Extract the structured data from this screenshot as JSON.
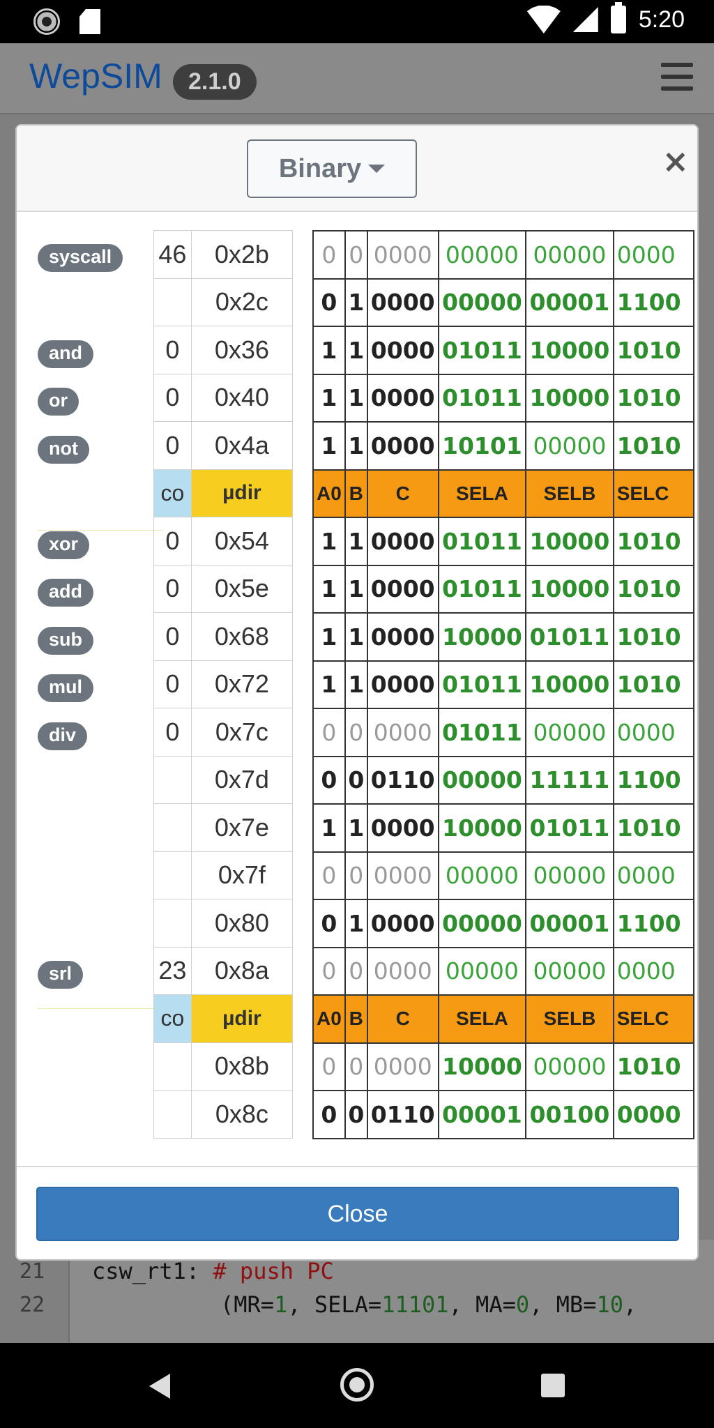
{
  "status_bar": {
    "time": "5:20"
  },
  "app": {
    "brand": "WepSIM",
    "version": "2.1.0",
    "editor": {
      "lines": [
        {
          "number": "21",
          "label": "csw_rt1: ",
          "comment": "# push PC"
        },
        {
          "number": "22",
          "prefix": "(MR=",
          "mr": "1",
          "s1": ", SELA=",
          "sela": "11101",
          "s2": ", MA=",
          "ma": "0",
          "s3": ", MB=",
          "mb": "10",
          "s4": ","
        }
      ]
    }
  },
  "modal": {
    "format_dropdown": "Binary",
    "close_x": "×",
    "close_button": "Close",
    "labels": [
      "syscall",
      "and",
      "or",
      "not",
      "xor",
      "add",
      "sub",
      "mul",
      "div",
      "srl"
    ],
    "header": {
      "co": "co",
      "udir": "µdir",
      "a0": "A0",
      "b": "B",
      "c": "C",
      "sela": "SELA",
      "selb": "SELB",
      "selc": "SELC"
    },
    "rows": [
      {
        "co": "46",
        "udir": "0x2b",
        "a0": "0",
        "b": "0",
        "c": "0000",
        "sela": "00000",
        "selb": "00000",
        "selc": "0000",
        "style": "muted"
      },
      {
        "co": "",
        "udir": "0x2c",
        "a0": "0",
        "b": "1",
        "c": "0000",
        "sela": "00000",
        "selb": "00001",
        "selc": "1100",
        "style": "bold"
      },
      {
        "co": "0",
        "udir": "0x36",
        "a0": "1",
        "b": "1",
        "c": "0000",
        "sela": "01011",
        "selb": "10000",
        "selc": "1010",
        "style": "bold"
      },
      {
        "co": "0",
        "udir": "0x40",
        "a0": "1",
        "b": "1",
        "c": "0000",
        "sela": "01011",
        "selb": "10000",
        "selc": "1010",
        "style": "bold"
      },
      {
        "co": "0",
        "udir": "0x4a",
        "a0": "1",
        "b": "1",
        "c": "0000",
        "sela": "10101",
        "selb": "00000",
        "selc": "1010",
        "style": "bold"
      },
      {
        "header": true
      },
      {
        "co": "0",
        "udir": "0x54",
        "a0": "1",
        "b": "1",
        "c": "0000",
        "sela": "01011",
        "selb": "10000",
        "selc": "1010",
        "style": "bold"
      },
      {
        "co": "0",
        "udir": "0x5e",
        "a0": "1",
        "b": "1",
        "c": "0000",
        "sela": "01011",
        "selb": "10000",
        "selc": "1010",
        "style": "bold"
      },
      {
        "co": "0",
        "udir": "0x68",
        "a0": "1",
        "b": "1",
        "c": "0000",
        "sela": "10000",
        "selb": "01011",
        "selc": "1010",
        "style": "bold"
      },
      {
        "co": "0",
        "udir": "0x72",
        "a0": "1",
        "b": "1",
        "c": "0000",
        "sela": "01011",
        "selb": "10000",
        "selc": "1010",
        "style": "bold"
      },
      {
        "co": "0",
        "udir": "0x7c",
        "a0": "0",
        "b": "0",
        "c": "0000",
        "sela": "01011",
        "selb": "00000",
        "selc": "0000",
        "style": "muted"
      },
      {
        "co": "",
        "udir": "0x7d",
        "a0": "0",
        "b": "0",
        "c": "0110",
        "sela": "00000",
        "selb": "11111",
        "selc": "1100",
        "style": "bold"
      },
      {
        "co": "",
        "udir": "0x7e",
        "a0": "1",
        "b": "1",
        "c": "0000",
        "sela": "10000",
        "selb": "01011",
        "selc": "1010",
        "style": "bold"
      },
      {
        "co": "",
        "udir": "0x7f",
        "a0": "0",
        "b": "0",
        "c": "0000",
        "sela": "00000",
        "selb": "00000",
        "selc": "0000",
        "style": "muted"
      },
      {
        "co": "",
        "udir": "0x80",
        "a0": "0",
        "b": "1",
        "c": "0000",
        "sela": "00000",
        "selb": "00001",
        "selc": "1100",
        "style": "bold"
      },
      {
        "co": "23",
        "udir": "0x8a",
        "a0": "0",
        "b": "0",
        "c": "0000",
        "sela": "00000",
        "selb": "00000",
        "selc": "0000",
        "style": "muted"
      },
      {
        "header": true
      },
      {
        "co": "",
        "udir": "0x8b",
        "a0": "0",
        "b": "0",
        "c": "0000",
        "sela": "10000",
        "selb": "00000",
        "selc": "1010",
        "style": "muted"
      },
      {
        "co": "",
        "udir": "0x8c",
        "a0": "0",
        "b": "0",
        "c": "0110",
        "sela": "00001",
        "selb": "00100",
        "selc": "0000",
        "style": "bold"
      }
    ]
  }
}
